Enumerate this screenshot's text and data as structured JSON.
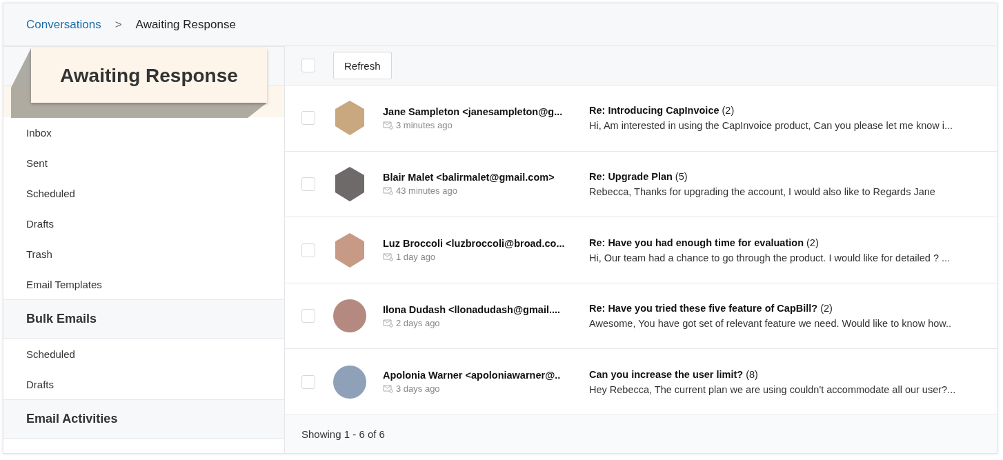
{
  "breadcrumb": {
    "items": [
      "Conversations",
      "Awaiting Response"
    ],
    "separator": ">"
  },
  "callout": {
    "label": "Awaiting Response"
  },
  "sidebar": {
    "sections": [
      {
        "items": [
          {
            "selected": true
          },
          {
            "label": "Inbox",
            "selected": false
          },
          {
            "label": "Sent",
            "selected": false
          },
          {
            "label": "Scheduled",
            "selected": false
          },
          {
            "label": "Drafts",
            "selected": false
          },
          {
            "label": "Trash",
            "selected": false
          },
          {
            "label": "Email Templates",
            "selected": false
          }
        ]
      },
      {
        "title": "Bulk Emails",
        "items": [
          {
            "label": "Scheduled",
            "selected": false
          },
          {
            "label": "Drafts",
            "selected": false
          }
        ]
      },
      {
        "title": "Email Activities"
      }
    ]
  },
  "toolbar": {
    "select_all": {
      "checked": false
    },
    "refresh": "Refresh"
  },
  "conversations": [
    {
      "kind": "hexagon",
      "sender": "Jane Sampleton <janesampleton@g...",
      "time": "3 minutes ago",
      "subject": "Re: Introducing CapInvoice",
      "count": "(2)",
      "preview": "Hi, Am interested in using the CapInvoice product, Can you please let me know i...",
      "checked": false
    },
    {
      "kind": "hexagon",
      "sender": "Blair Malet <balirmalet@gmail.com>",
      "time": "43 minutes ago",
      "subject": "Re: Upgrade Plan",
      "count": "(5)",
      "preview": "Rebecca, Thanks for upgrading the account, I would also like to Regards Jane",
      "checked": false
    },
    {
      "kind": "hexagon",
      "sender": "Luz Broccoli <luzbroccoli@broad.co...",
      "time": "1 day ago",
      "subject": "Re: Have you had enough time for evaluation",
      "count": "(2)",
      "preview": "Hi, Our team had a chance to go through the product. I would like for detailed ? ...",
      "checked": false
    },
    {
      "kind": "circle",
      "sender": "Ilona Dudash <llonadudash@gmail....",
      "time": "2 days ago",
      "subject": "Re: Have you tried these five feature of CapBill?",
      "count": "(2)",
      "preview": "Awesome, You have got set of relevant feature we need. Would like to know how..",
      "checked": false
    },
    {
      "kind": "circle",
      "sender": "Apolonia Warner <apoloniawarner@..",
      "time": "3 days ago",
      "subject": "Can you increase the user limit?",
      "count": "(8)",
      "preview": "Hey Rebecca, The current plan we are using couldn't accommodate all our user?...",
      "checked": false
    }
  ],
  "footer": "Showing 1 - 6 of 6"
}
